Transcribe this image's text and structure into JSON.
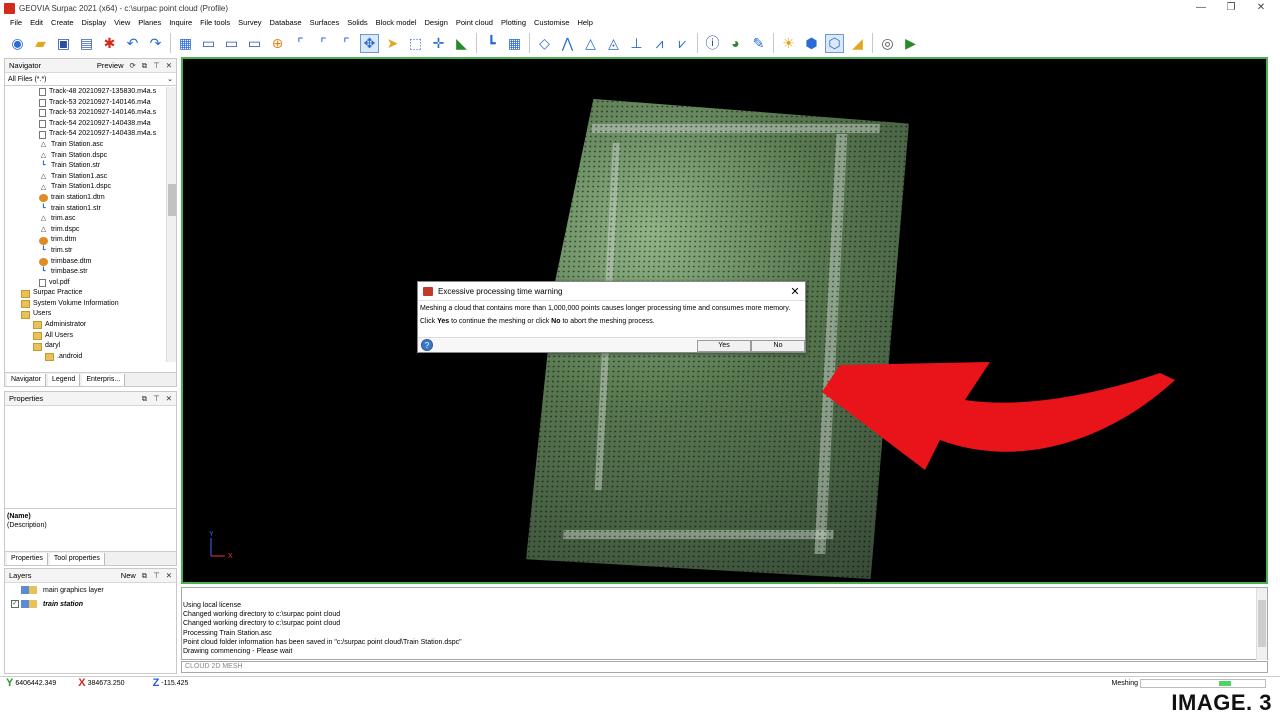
{
  "window": {
    "title": "GEOVIA Surpac 2021 (x64) - c:\\surpac point cloud (Profile)",
    "controls": [
      "—",
      "❐",
      "✕"
    ]
  },
  "menu": [
    "File",
    "Edit",
    "Create",
    "Display",
    "View",
    "Planes",
    "Inquire",
    "File tools",
    "Survey",
    "Database",
    "Surfaces",
    "Solids",
    "Block model",
    "Design",
    "Point cloud",
    "Plotting",
    "Customise",
    "Help"
  ],
  "navigator": {
    "title": "Navigator",
    "preview_label": "Preview",
    "filter": "All Files (*.*)",
    "items": [
      {
        "label": "Track-48 20210927-135830.m4a.s",
        "icon": "file-icon"
      },
      {
        "label": "Track-53 20210927-140146.m4a",
        "icon": "file-icon"
      },
      {
        "label": "Track-53 20210927-140146.m4a.s",
        "icon": "file-icon"
      },
      {
        "label": "Track-54 20210927-140438.m4a",
        "icon": "file-icon"
      },
      {
        "label": "Track-54 20210927-140438.m4a.s",
        "icon": "file-icon"
      },
      {
        "label": "Train Station.asc",
        "icon": "asc-icon"
      },
      {
        "label": "Train Station.dspc",
        "icon": "dspc-icon"
      },
      {
        "label": "Train Station.str",
        "icon": "string-icon"
      },
      {
        "label": "Train Station1.asc",
        "icon": "asc-icon"
      },
      {
        "label": "Train Station1.dspc",
        "icon": "dspc-icon"
      },
      {
        "label": "train station1.dtm",
        "icon": "dtm-icon"
      },
      {
        "label": "train station1.str",
        "icon": "string-icon"
      },
      {
        "label": "trim.asc",
        "icon": "asc-icon"
      },
      {
        "label": "trim.dspc",
        "icon": "dspc-icon"
      },
      {
        "label": "trim.dtm",
        "icon": "dtm-icon"
      },
      {
        "label": "trim.str",
        "icon": "string-icon"
      },
      {
        "label": "trimbase.dtm",
        "icon": "dtm-icon"
      },
      {
        "label": "trimbase.str",
        "icon": "string-icon"
      },
      {
        "label": "vol.pdf",
        "icon": "file-icon"
      },
      {
        "label": "Surpac Practice",
        "icon": "folder-icon"
      },
      {
        "label": "System Volume Information",
        "icon": "folder-icon"
      },
      {
        "label": "Users",
        "icon": "folder-icon"
      },
      {
        "label": "Administrator",
        "icon": "folder-icon"
      },
      {
        "label": "All Users",
        "icon": "folder-icon"
      },
      {
        "label": "daryl",
        "icon": "folder-icon"
      },
      {
        "label": ".android",
        "icon": "folder-icon"
      }
    ],
    "tabs": [
      "Navigator",
      "Legend",
      "Enterpris..."
    ]
  },
  "properties": {
    "title": "Properties",
    "name_label": "(Name)",
    "description_label": "(Description)",
    "tabs": [
      "Properties",
      "Tool properties"
    ]
  },
  "layers": {
    "title": "Layers",
    "new_label": "New",
    "rows": [
      {
        "label": "main graphics layer",
        "checked": false,
        "bold": false
      },
      {
        "label": "train station",
        "checked": true,
        "bold": true
      }
    ]
  },
  "dialog": {
    "title": "Excessive processing time warning",
    "message_line1": "Meshing a cloud that contains more than 1,000,000 points causes longer processing time and consumes more memory.",
    "msg2_a": "Click ",
    "msg2_yes": "Yes",
    "msg2_b": " to continue the meshing or click ",
    "msg2_no": "No",
    "msg2_c": " to abort the meshing process.",
    "yes_label": "Yes",
    "no_label": "No",
    "help_label": "?"
  },
  "viewport": {
    "axis_y": "Y",
    "axis_x": "X"
  },
  "output": {
    "lines": [
      "Using local license",
      "Changed working directory to c:\\surpac point cloud",
      "Changed working directory to c:\\surpac point cloud",
      "Processing Train Station.asc",
      "Point cloud folder information has been saved in \"c:/surpac point cloud\\Train Station.dspc\"",
      "Drawing commencing - Please wait"
    ],
    "command_line": "CLOUD 2D MESH"
  },
  "status": {
    "y": "6406442.349",
    "x": "384673.250",
    "z": "-115.425",
    "activity": "Meshing",
    "progress_fraction": 0.1
  },
  "caption": "IMAGE. 3",
  "colors": {
    "accent_green": "#4caf50",
    "arrow_red": "#e8141a"
  }
}
